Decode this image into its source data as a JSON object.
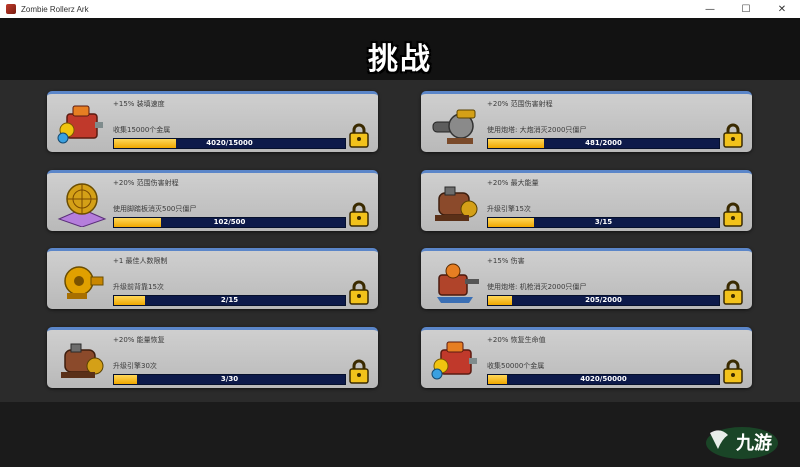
{
  "window": {
    "title": "Zombie Rollerz Ark",
    "minimize": "—",
    "maximize": "☐",
    "close": "✕"
  },
  "page": {
    "title": "挑战"
  },
  "challenges": [
    {
      "icon": "red-mechanical-ark-icon",
      "bonus": "+15% 装填速度",
      "task": "收集15000个金属",
      "progress_text": "4020/15000",
      "progress": 0.268
    },
    {
      "icon": "cannon-turret-icon",
      "bonus": "+20% 范围伤害射程",
      "task": "使用炮塔: 大炮消灭2000只僵尸",
      "progress_text": "481/2000",
      "progress": 0.2405
    },
    {
      "icon": "tesla-orb-icon",
      "bonus": "+20% 范围伤害射程",
      "task": "使用脚踏板消灭500只僵尸",
      "progress_text": "102/500",
      "progress": 0.204
    },
    {
      "icon": "engine-part-icon",
      "bonus": "+20% 最大能量",
      "task": "升级引擎15次",
      "progress_text": "3/15",
      "progress": 0.2
    },
    {
      "icon": "gold-gear-icon",
      "bonus": "+1 最佳人数限制",
      "task": "升级前背靠15次",
      "progress_text": "2/15",
      "progress": 0.133
    },
    {
      "icon": "machine-gun-turret-icon",
      "bonus": "+15% 伤害",
      "task": "使用炮塔: 机枪消灭2000只僵尸",
      "progress_text": "205/2000",
      "progress": 0.1025
    },
    {
      "icon": "engine-part-icon",
      "bonus": "+20% 能量恢复",
      "task": "升级引擎30次",
      "progress_text": "3/30",
      "progress": 0.1
    },
    {
      "icon": "red-mechanical-ark-icon",
      "bonus": "+20% 恢复生命值",
      "task": "收集50000个金属",
      "progress_text": "4020/50000",
      "progress": 0.0804
    }
  ],
  "watermark": {
    "text": "九游"
  },
  "colors": {
    "card_border": "#5b86c9",
    "bar_bg": "#0d1a4a",
    "bar_fill": "#f0a800",
    "lock": "#f2c21b"
  }
}
